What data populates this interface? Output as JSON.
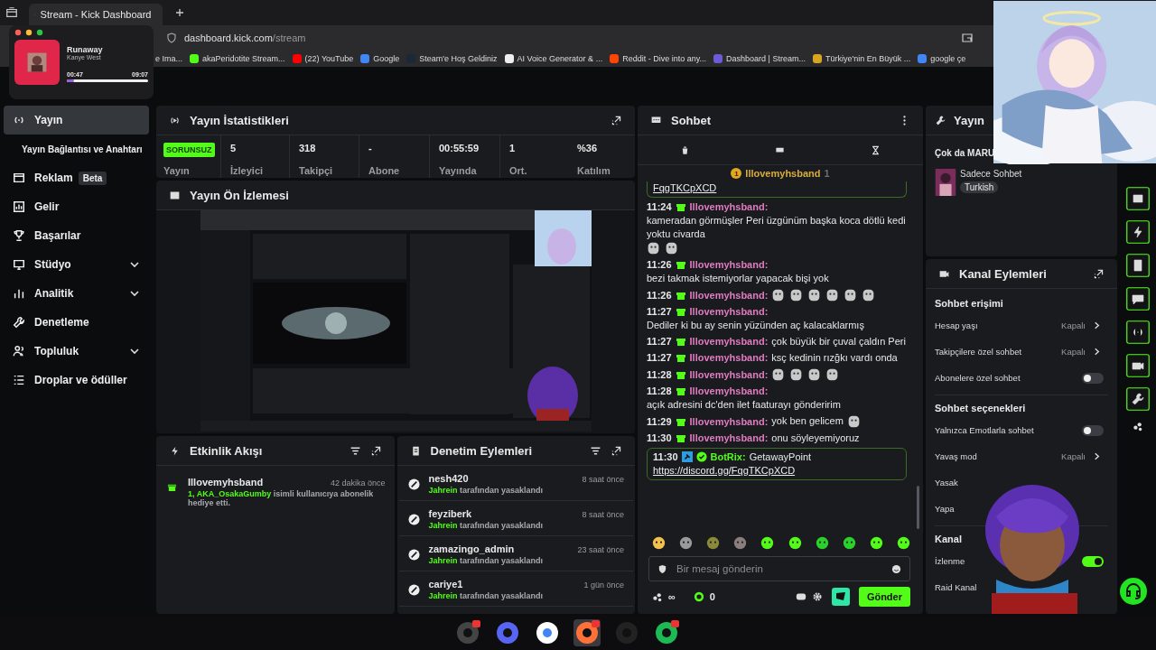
{
  "browser": {
    "tab_title": "Stream - Kick Dashboard",
    "url_host": "dashboard.kick.com",
    "url_path": "/stream",
    "bookmarks": [
      "e Ima...",
      "akaPeridotite Stream...",
      "(22) YouTube",
      "Google",
      "Steam'e Hoş Geldiniz",
      "AI Voice Generator & ...",
      "Reddit - Dive into any...",
      "Dashboard | Stream...",
      "Türkiye'nin En Büyük ...",
      "google çe"
    ]
  },
  "media_player": {
    "title": "Runaway",
    "artist": "Kanye West",
    "elapsed": "00:47",
    "duration": "09:07",
    "level": 0.09
  },
  "sidebar": [
    {
      "label": "Yayın",
      "kind": "link",
      "selected": true
    },
    {
      "label": "Yayın Bağlantısı ve Anahtarı",
      "kind": "sub",
      "selected": false
    },
    {
      "label": "Reklam",
      "kind": "link",
      "selected": false,
      "badge": "Beta"
    },
    {
      "label": "Gelir",
      "kind": "link",
      "selected": false
    },
    {
      "label": "Başarılar",
      "kind": "link",
      "selected": false
    },
    {
      "label": "Stüdyo",
      "kind": "group",
      "selected": false,
      "expanded": false
    },
    {
      "label": "Analitik",
      "kind": "group",
      "selected": false,
      "expanded": false
    },
    {
      "label": "Denetleme",
      "kind": "link",
      "selected": false
    },
    {
      "label": "Topluluk",
      "kind": "group",
      "selected": false,
      "expanded": false
    },
    {
      "label": "Droplar ve ödüller",
      "kind": "link",
      "selected": false
    }
  ],
  "stats": {
    "title": "Yayın İstatistikleri",
    "status_badge": "SORUNSUZ",
    "status_label": "Yayın",
    "items": [
      {
        "value": "5",
        "label": "İzleyici"
      },
      {
        "value": "318",
        "label": "Takipçi"
      },
      {
        "value": "-",
        "label": "Abone"
      },
      {
        "value": "00:55:59",
        "label": "Yayında"
      },
      {
        "value": "1",
        "label": "Ort."
      },
      {
        "value": "%36",
        "label": "Katılım"
      }
    ]
  },
  "preview": {
    "title": "Yayın Ön İzlemesi"
  },
  "activity": {
    "title": "Etkinlik Akışı",
    "events": [
      {
        "user": "Illovemyhsband",
        "time": "42 dakika önce",
        "target": "1, AKA_OsakaGumby",
        "message": "isimli kullanıcıya abonelik hediye etti."
      }
    ]
  },
  "moderation": {
    "title": "Denetim Eylemleri",
    "actions": [
      {
        "user": "nesh420",
        "time": "8 saat önce",
        "moderator": "Jahrein",
        "action": "tarafından yasaklandı"
      },
      {
        "user": "feyziberk",
        "time": "8 saat önce",
        "moderator": "Jahrein",
        "action": "tarafından yasaklandı"
      },
      {
        "user": "zamazingo_admin",
        "time": "23 saat önce",
        "moderator": "Jahrein",
        "action": "tarafından yasaklandı"
      },
      {
        "user": "cariye1",
        "time": "1 gün önce",
        "moderator": "Jahrein",
        "action": "tarafından yasaklandı"
      }
    ]
  },
  "chat": {
    "title": "Sohbet",
    "pinned": {
      "rank": "1",
      "user": "Illovemyhsband",
      "count": "1"
    },
    "messages": [
      {
        "kind": "fragment",
        "link": "FqgTKCpXCD"
      },
      {
        "kind": "user",
        "time": "11:24",
        "user": "Illovemyhsband:",
        "text": "kameradan görmüşler Peri üzgünüm başka koca dötlü kedi yoktu civarda"
      },
      {
        "kind": "user",
        "time": "11:26",
        "user": "Illovemyhsband:",
        "text": "bezi takmak istemiyorlar yapacak bişi yok"
      },
      {
        "kind": "user",
        "time": "11:26",
        "user": "Illovemyhsband:"
      },
      {
        "kind": "user",
        "time": "11:27",
        "user": "Illovemyhsband:",
        "text": "Dediler ki bu ay senin yüzünden aç kalacaklarmış"
      },
      {
        "kind": "user",
        "time": "11:27",
        "user": "Illovemyhsband:",
        "text": "çok büyük bir çuval çaldın Peri"
      },
      {
        "kind": "user",
        "time": "11:27",
        "user": "Illovemyhsband:",
        "text": "ksç kedinin rızğkı vardı onda"
      },
      {
        "kind": "user",
        "time": "11:28",
        "user": "Illovemyhsband:"
      },
      {
        "kind": "user",
        "time": "11:28",
        "user": "Illovemyhsband:",
        "text": "açık adresini dc'den ilet faaturayı gönderirim"
      },
      {
        "kind": "user",
        "time": "11:29",
        "user": "Illovemyhsband:",
        "text": "yok ben gelicem"
      },
      {
        "kind": "user",
        "time": "11:30",
        "user": "Illovemyhsband:",
        "text": "onu söyleyemiyoruz"
      },
      {
        "kind": "bot",
        "time": "11:30",
        "user": "BotRix:",
        "text": "GetawayPoint",
        "link": "https://discord.gg/FqgTKCpXCD"
      }
    ],
    "placeholder": "Bir mesaj gönderin",
    "points": "∞",
    "coins": "0",
    "send": "Gönder"
  },
  "stream_info": {
    "title": "Yayın",
    "stream_title": "Çok da MARU",
    "category": "Sadece Sohbet",
    "tag": "Turkish"
  },
  "channel_actions": {
    "title": "Kanal Eylemleri",
    "sections": [
      {
        "title": "Sohbet erişimi",
        "rows": [
          {
            "kind": "select",
            "label": "Hesap yaşı",
            "value": "Kapalı"
          },
          {
            "kind": "select",
            "label": "Takipçilere özel sohbet",
            "value": "Kapalı"
          },
          {
            "kind": "toggle",
            "label": "Abonelere özel sohbet",
            "on": false
          }
        ]
      },
      {
        "title": "Sohbet seçenekleri",
        "rows": [
          {
            "kind": "toggle",
            "label": "Yalnızca Emotlarla sohbet",
            "on": false
          },
          {
            "kind": "select",
            "label": "Yavaş mod",
            "value": "Kapalı"
          },
          {
            "kind": "cut",
            "label": "Yasak"
          },
          {
            "kind": "cut",
            "label": "Yapa"
          }
        ]
      },
      {
        "title": "Kanal",
        "rows": [
          {
            "kind": "toggle",
            "label": "İzlenme",
            "on": true
          },
          {
            "kind": "cut",
            "label": "Raid Kanal"
          }
        ]
      }
    ]
  }
}
